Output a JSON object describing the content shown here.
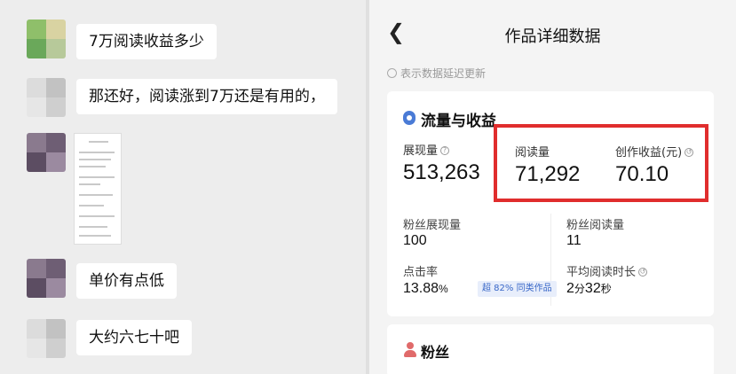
{
  "chat": {
    "messages": [
      {
        "text": "7万阅读收益多少"
      },
      {
        "text": "那还好，阅读涨到7万还是有用的，"
      },
      {
        "type": "image"
      },
      {
        "text": "单价有点低"
      },
      {
        "text": "大约六七十吧"
      }
    ]
  },
  "phone": {
    "title": "作品详细数据",
    "notice": "表示数据延迟更新",
    "traffic": {
      "title": "流量与收益",
      "impressions_label": "展现量",
      "impressions_value": "513,263",
      "reads_label": "阅读量",
      "reads_value": "71,292",
      "earnings_label": "创作收益(元)",
      "earnings_value": "70.10",
      "fan_impressions_label": "粉丝展现量",
      "fan_impressions_value": "100",
      "fan_reads_label": "粉丝阅读量",
      "fan_reads_value": "11",
      "ctr_label": "点击率",
      "ctr_value": "13.88",
      "ctr_unit": "%",
      "ctr_badge": "超 82% 同类作品",
      "avg_read_label": "平均阅读时长",
      "avg_read_min": "2",
      "avg_read_min_unit": "分",
      "avg_read_sec": "32",
      "avg_read_sec_unit": "秒"
    },
    "fans": {
      "title": "粉丝"
    }
  },
  "colors": {
    "highlight": "#e02d2d",
    "accent": "#4a7bd6",
    "badge_text": "#3a68c8"
  }
}
